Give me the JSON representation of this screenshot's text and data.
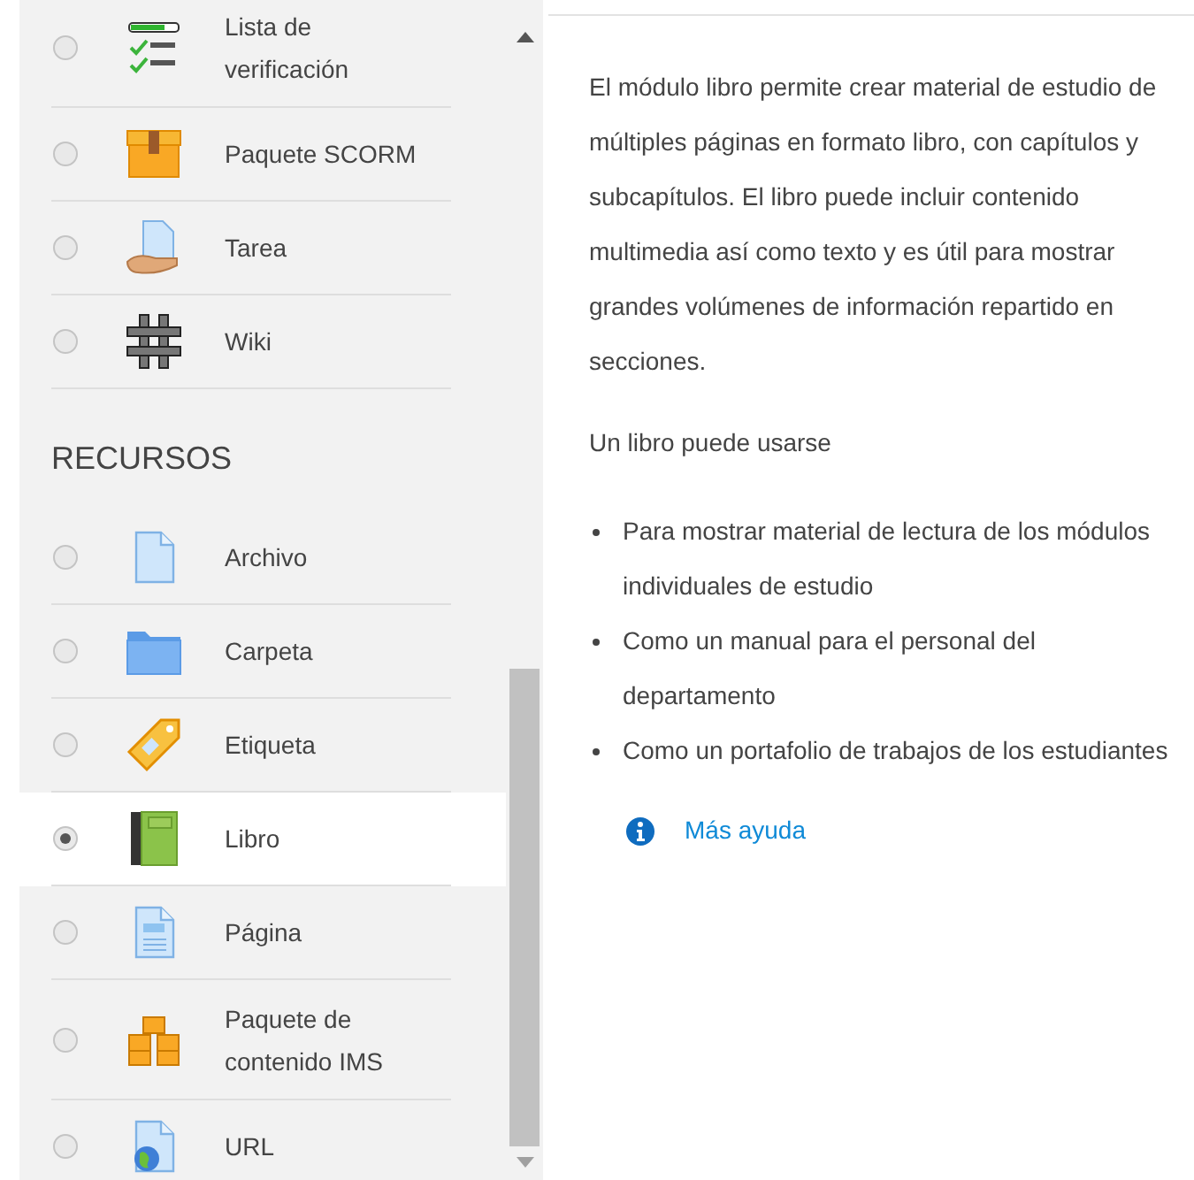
{
  "sections": [
    {
      "items": [
        {
          "label": "Lista de verificación",
          "selected": false
        },
        {
          "label": "Paquete SCORM",
          "selected": false
        },
        {
          "label": "Tarea",
          "selected": false
        },
        {
          "label": "Wiki",
          "selected": false
        }
      ]
    },
    {
      "heading": "RECURSOS",
      "items": [
        {
          "label": "Archivo",
          "selected": false
        },
        {
          "label": "Carpeta",
          "selected": false
        },
        {
          "label": "Etiqueta",
          "selected": false
        },
        {
          "label": "Libro",
          "selected": true
        },
        {
          "label": "Página",
          "selected": false
        },
        {
          "label": "Paquete de contenido IMS",
          "selected": false
        },
        {
          "label": "URL",
          "selected": false
        }
      ]
    }
  ],
  "help": {
    "description": "El módulo libro permite crear material de estudio de múltiples páginas en formato libro, con capítulos y subcapítulos. El libro puede incluir contenido multimedia así como texto y es útil para mostrar grandes volúmenes de información repartido en secciones.",
    "intro": "Un libro puede usarse",
    "uses": [
      "Para mostrar material de lectura de los módulos individuales de estudio",
      "Como un manual para el personal del departamento",
      "Como un portafolio de trabajos de los estudiantes"
    ],
    "more_link": "Más ayuda"
  }
}
